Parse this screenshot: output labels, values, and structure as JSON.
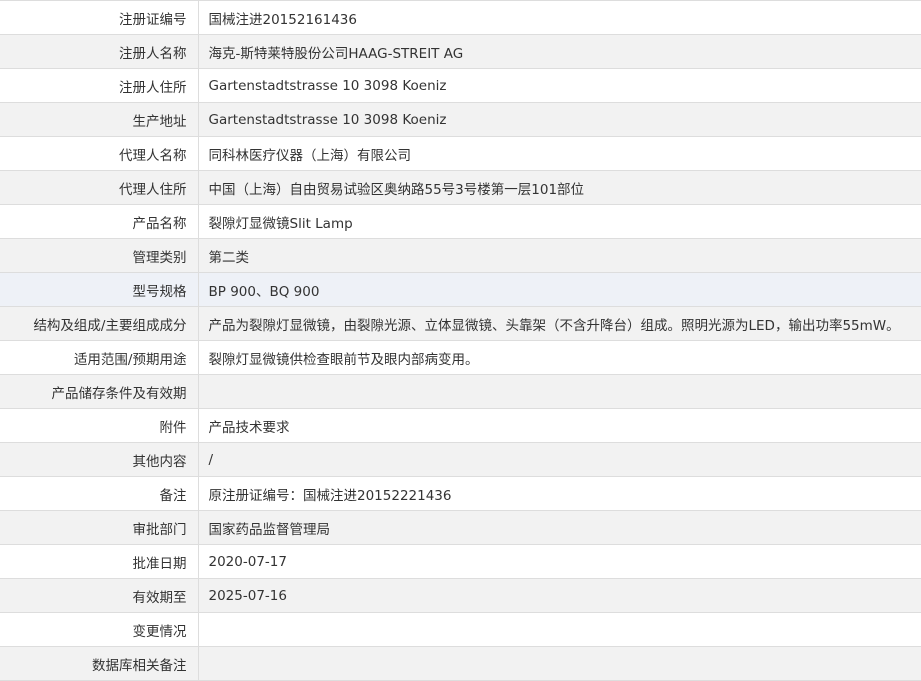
{
  "rows": [
    {
      "label": "注册证编号",
      "value": "国械注进20152161436"
    },
    {
      "label": "注册人名称",
      "value": "海克-斯特莱特股份公司HAAG-STREIT AG"
    },
    {
      "label": "注册人住所",
      "value": "Gartenstadtstrasse 10 3098 Koeniz"
    },
    {
      "label": "生产地址",
      "value": "Gartenstadtstrasse 10 3098 Koeniz"
    },
    {
      "label": "代理人名称",
      "value": "同科林医疗仪器（上海）有限公司"
    },
    {
      "label": "代理人住所",
      "value": "中国（上海）自由贸易试验区奥纳路55号3号楼第一层101部位"
    },
    {
      "label": "产品名称",
      "value": "裂隙灯显微镜Slit Lamp"
    },
    {
      "label": "管理类别",
      "value": "第二类"
    },
    {
      "label": "型号规格",
      "value": "BP 900、BQ 900"
    },
    {
      "label": "结构及组成/主要组成成分",
      "value": "产品为裂隙灯显微镜，由裂隙光源、立体显微镜、头靠架（不含升降台）组成。照明光源为LED，输出功率55mW。"
    },
    {
      "label": "适用范围/预期用途",
      "value": "裂隙灯显微镜供检查眼前节及眼内部病变用。"
    },
    {
      "label": "产品储存条件及有效期",
      "value": ""
    },
    {
      "label": "附件",
      "value": "产品技术要求"
    },
    {
      "label": "其他内容",
      "value": "/"
    },
    {
      "label": "备注",
      "value": "原注册证编号：国械注进20152221436"
    },
    {
      "label": "审批部门",
      "value": "国家药品监督管理局"
    },
    {
      "label": "批准日期",
      "value": "2020-07-17"
    },
    {
      "label": "有效期至",
      "value": "2025-07-16"
    },
    {
      "label": "变更情况",
      "value": ""
    },
    {
      "label": "数据库相关备注",
      "value": ""
    }
  ]
}
